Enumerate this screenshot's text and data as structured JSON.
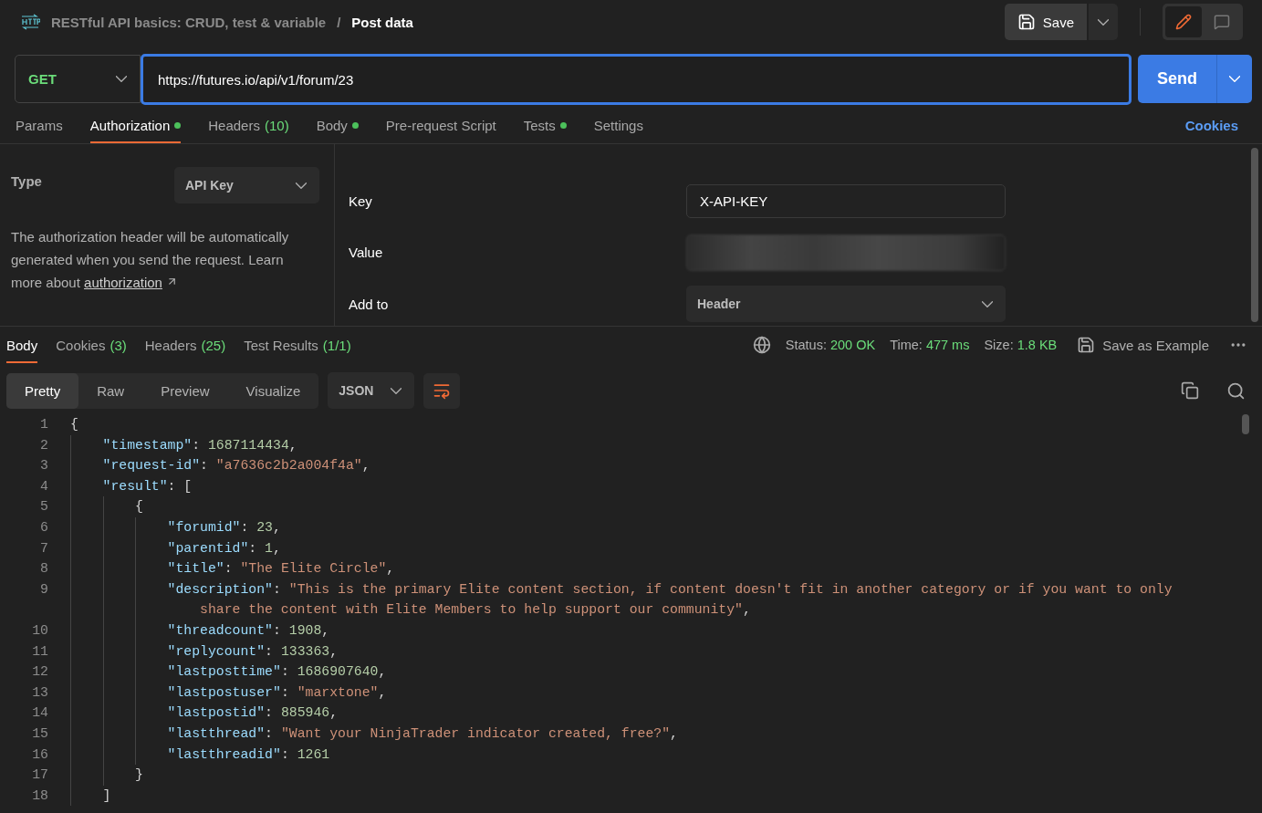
{
  "header": {
    "breadcrumb_parent": "RESTful API basics: CRUD, test & variable",
    "separator": "/",
    "title": "Post data",
    "save_label": "Save",
    "modes": [
      {
        "kind": "edit",
        "selected": true
      },
      {
        "kind": "comments",
        "selected": false
      }
    ]
  },
  "request": {
    "method": "GET",
    "url": "https://futures.io/api/v1/forum/23",
    "send_label": "Send"
  },
  "request_tabs": [
    {
      "label": "Params",
      "selected": false
    },
    {
      "label": "Authorization",
      "selected": true,
      "dot": true
    },
    {
      "label": "Headers",
      "count": "(10)",
      "selected": false
    },
    {
      "label": "Body",
      "selected": false,
      "dot": true
    },
    {
      "label": "Pre-request Script",
      "selected": false
    },
    {
      "label": "Tests",
      "selected": false,
      "dot": true
    },
    {
      "label": "Settings",
      "selected": false
    }
  ],
  "cookies_link": "Cookies",
  "auth": {
    "type_label": "Type",
    "type_value": "API Key",
    "description_before": "The authorization header will be automatically generated when you send the request. Learn more about ",
    "description_link": "authorization",
    "fields": [
      {
        "label": "Key",
        "kind": "text",
        "value": "X-API-KEY"
      },
      {
        "label": "Value",
        "kind": "hidden"
      },
      {
        "label": "Add to",
        "kind": "select",
        "value": "Header"
      }
    ]
  },
  "response_tabs": [
    {
      "label": "Body",
      "selected": true
    },
    {
      "label": "Cookies",
      "count": "(3)",
      "selected": false
    },
    {
      "label": "Headers",
      "count": "(25)",
      "selected": false
    },
    {
      "label": "Test Results",
      "count": "(1/1)",
      "selected": false
    }
  ],
  "response_meta": [
    {
      "label": "Status:",
      "value": "200 OK"
    },
    {
      "label": "Time:",
      "value": "477 ms"
    },
    {
      "label": "Size:",
      "value": "1.8 KB"
    }
  ],
  "save_example": "Save as Example",
  "view_modes": [
    {
      "label": "Pretty",
      "selected": true
    },
    {
      "label": "Raw",
      "selected": false
    },
    {
      "label": "Preview",
      "selected": false
    },
    {
      "label": "Visualize",
      "selected": false
    }
  ],
  "format": "JSON",
  "code_lines": [
    {
      "number": "1",
      "tokens": [
        {
          "kind": "punct",
          "text": "{"
        }
      ],
      "children": [
        {
          "number": "2",
          "tokens": [
            {
              "kind": "key",
              "text": "\"timestamp\""
            },
            {
              "kind": "punct",
              "text": ": "
            },
            {
              "kind": "number",
              "text": "1687114434"
            },
            {
              "kind": "punct",
              "text": ","
            }
          ]
        },
        {
          "number": "3",
          "tokens": [
            {
              "kind": "key",
              "text": "\"request-id\""
            },
            {
              "kind": "punct",
              "text": ": "
            },
            {
              "kind": "string",
              "text": "\"a7636c2b2a004f4a\""
            },
            {
              "kind": "punct",
              "text": ","
            }
          ]
        },
        {
          "number": "4",
          "tokens": [
            {
              "kind": "key",
              "text": "\"result\""
            },
            {
              "kind": "punct",
              "text": ": ["
            }
          ],
          "children": [
            {
              "number": "5",
              "tokens": [
                {
                  "kind": "punct",
                  "text": "{"
                }
              ],
              "children": [
                {
                  "number": "6",
                  "tokens": [
                    {
                      "kind": "key",
                      "text": "\"forumid\""
                    },
                    {
                      "kind": "punct",
                      "text": ": "
                    },
                    {
                      "kind": "number",
                      "text": "23"
                    },
                    {
                      "kind": "punct",
                      "text": ","
                    }
                  ]
                },
                {
                  "number": "7",
                  "tokens": [
                    {
                      "kind": "key",
                      "text": "\"parentid\""
                    },
                    {
                      "kind": "punct",
                      "text": ": "
                    },
                    {
                      "kind": "number",
                      "text": "1"
                    },
                    {
                      "kind": "punct",
                      "text": ","
                    }
                  ]
                },
                {
                  "number": "8",
                  "tokens": [
                    {
                      "kind": "key",
                      "text": "\"title\""
                    },
                    {
                      "kind": "punct",
                      "text": ": "
                    },
                    {
                      "kind": "string",
                      "text": "\"The Elite Circle\""
                    },
                    {
                      "kind": "punct",
                      "text": ","
                    }
                  ]
                },
                {
                  "number": "9",
                  "tokens": [
                    {
                      "kind": "key",
                      "text": "\"description\""
                    },
                    {
                      "kind": "punct",
                      "text": ": "
                    },
                    {
                      "kind": "string",
                      "text": "\"This is the primary Elite content section, if content doesn't fit in another category or if you want to only share the content with Elite Members to help support our community\""
                    },
                    {
                      "kind": "punct",
                      "text": ","
                    }
                  ]
                },
                {
                  "number": "10",
                  "tokens": [
                    {
                      "kind": "key",
                      "text": "\"threadcount\""
                    },
                    {
                      "kind": "punct",
                      "text": ": "
                    },
                    {
                      "kind": "number",
                      "text": "1908"
                    },
                    {
                      "kind": "punct",
                      "text": ","
                    }
                  ]
                },
                {
                  "number": "11",
                  "tokens": [
                    {
                      "kind": "key",
                      "text": "\"replycount\""
                    },
                    {
                      "kind": "punct",
                      "text": ": "
                    },
                    {
                      "kind": "number",
                      "text": "133363"
                    },
                    {
                      "kind": "punct",
                      "text": ","
                    }
                  ]
                },
                {
                  "number": "12",
                  "tokens": [
                    {
                      "kind": "key",
                      "text": "\"lastposttime\""
                    },
                    {
                      "kind": "punct",
                      "text": ": "
                    },
                    {
                      "kind": "number",
                      "text": "1686907640"
                    },
                    {
                      "kind": "punct",
                      "text": ","
                    }
                  ]
                },
                {
                  "number": "13",
                  "tokens": [
                    {
                      "kind": "key",
                      "text": "\"lastpostuser\""
                    },
                    {
                      "kind": "punct",
                      "text": ": "
                    },
                    {
                      "kind": "string",
                      "text": "\"marxtone\""
                    },
                    {
                      "kind": "punct",
                      "text": ","
                    }
                  ]
                },
                {
                  "number": "14",
                  "tokens": [
                    {
                      "kind": "key",
                      "text": "\"lastpostid\""
                    },
                    {
                      "kind": "punct",
                      "text": ": "
                    },
                    {
                      "kind": "number",
                      "text": "885946"
                    },
                    {
                      "kind": "punct",
                      "text": ","
                    }
                  ]
                },
                {
                  "number": "15",
                  "tokens": [
                    {
                      "kind": "key",
                      "text": "\"lastthread\""
                    },
                    {
                      "kind": "punct",
                      "text": ": "
                    },
                    {
                      "kind": "string",
                      "text": "\"Want your NinjaTrader indicator created, free?\""
                    },
                    {
                      "kind": "punct",
                      "text": ","
                    }
                  ]
                },
                {
                  "number": "16",
                  "tokens": [
                    {
                      "kind": "key",
                      "text": "\"lastthreadid\""
                    },
                    {
                      "kind": "punct",
                      "text": ": "
                    },
                    {
                      "kind": "number",
                      "text": "1261"
                    }
                  ]
                }
              ]
            },
            {
              "number": "17",
              "tokens": [
                {
                  "kind": "punct",
                  "text": "}"
                }
              ]
            }
          ]
        },
        {
          "number": "18",
          "tokens": [
            {
              "kind": "punct",
              "text": "]"
            }
          ]
        }
      ]
    }
  ]
}
